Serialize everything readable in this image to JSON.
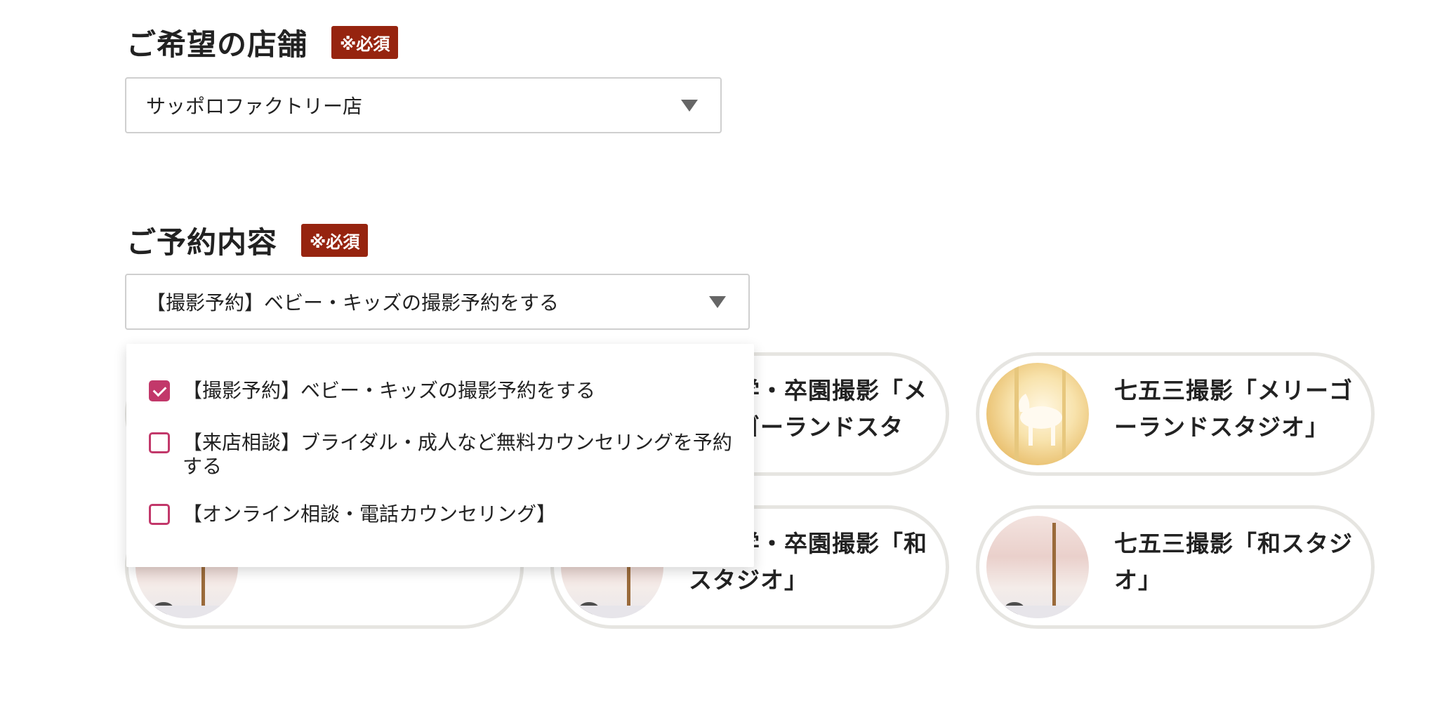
{
  "store_section": {
    "title": "ご希望の店舗",
    "required_badge": "※必須",
    "selected": "サッポロファクトリー店"
  },
  "reservation_section": {
    "title": "ご予約内容",
    "required_badge": "※必須",
    "selected": "【撮影予約】ベビー・キッズの撮影予約をする"
  },
  "dropdown": {
    "options": [
      {
        "label": "【撮影予約】ベビー・キッズの撮影予約をする",
        "checked": true
      },
      {
        "label": "【来店相談】ブライダル・成人など無料カウンセリングを予約する",
        "checked": false
      },
      {
        "label": "【オンライン相談・電話カウンセリング】",
        "checked": false
      }
    ]
  },
  "cards": [
    {
      "title": "",
      "image": "carousel-horse"
    },
    {
      "title": "卒入学・卒園撮影「メリーゴーランドスタ",
      "image": "carousel-horse"
    },
    {
      "title": "七五三撮影「メリーゴーランドスタジオ」",
      "image": "carousel-horse"
    },
    {
      "title": "オ」",
      "image": "wa-studio"
    },
    {
      "title": "卒入学・卒園撮影「和スタジオ」",
      "image": "wa-studio"
    },
    {
      "title": "七五三撮影「和スタジオ」",
      "image": "wa-studio"
    }
  ],
  "colors": {
    "badge": "#96240f",
    "checkbox": "#c2386a",
    "card_border": "#e6e5e1"
  }
}
